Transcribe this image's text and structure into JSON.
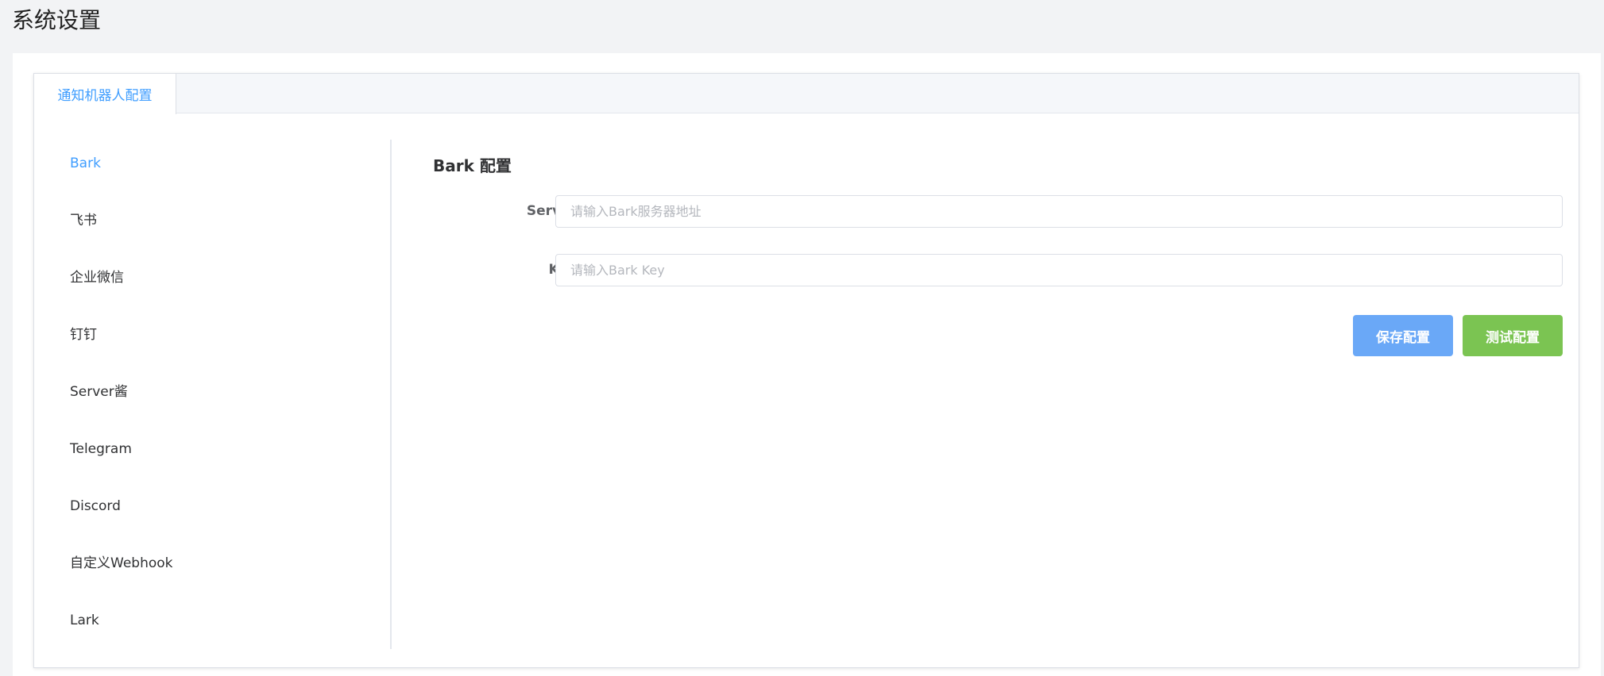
{
  "page": {
    "title": "系统设置"
  },
  "tabs": [
    {
      "label": "通知机器人配置",
      "active": true
    }
  ],
  "sidebar": {
    "items": [
      {
        "label": "Bark",
        "active": true
      },
      {
        "label": "飞书"
      },
      {
        "label": "企业微信"
      },
      {
        "label": "钉钉"
      },
      {
        "label": "Server酱"
      },
      {
        "label": "Telegram"
      },
      {
        "label": "Discord"
      },
      {
        "label": "自定义Webhook"
      },
      {
        "label": "Lark"
      }
    ]
  },
  "form": {
    "title": "Bark 配置",
    "fields": [
      {
        "label": "Server",
        "value": "",
        "placeholder": "请输入Bark服务器地址"
      },
      {
        "label": "Key",
        "value": "",
        "placeholder": "请输入Bark Key"
      }
    ],
    "buttons": {
      "save": "保存配置",
      "test": "测试配置"
    }
  },
  "colors": {
    "accent": "#409eff",
    "save_button": "#6aa8f7",
    "test_button": "#7bc452",
    "page_background": "#f2f3f5"
  }
}
